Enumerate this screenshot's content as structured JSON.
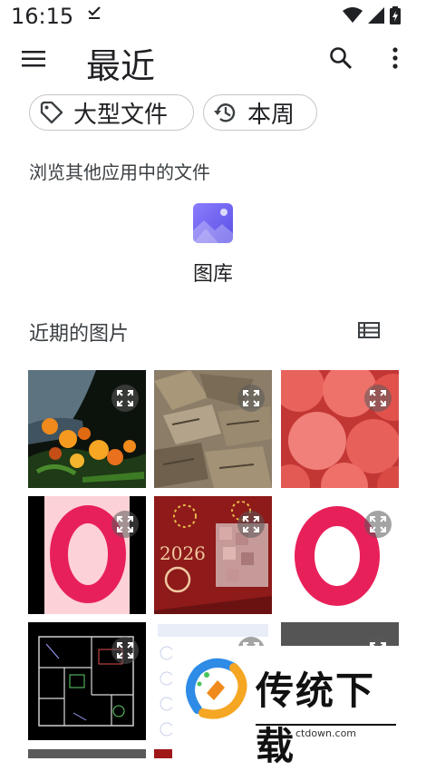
{
  "status": {
    "time": "16:15"
  },
  "header": {
    "title": "最近"
  },
  "chips": [
    {
      "label": "大型文件"
    },
    {
      "label": "本周"
    }
  ],
  "browse": {
    "label": "浏览其他应用中的文件",
    "apps": [
      {
        "label": "图库"
      }
    ]
  },
  "recent": {
    "title": "近期的图片"
  },
  "watermark": {
    "title": "传统下载",
    "url": "ctdown.com"
  },
  "colors": {
    "accent": "#6c5ce7",
    "chip_border": "#c4c7c5",
    "text": "#202124"
  }
}
